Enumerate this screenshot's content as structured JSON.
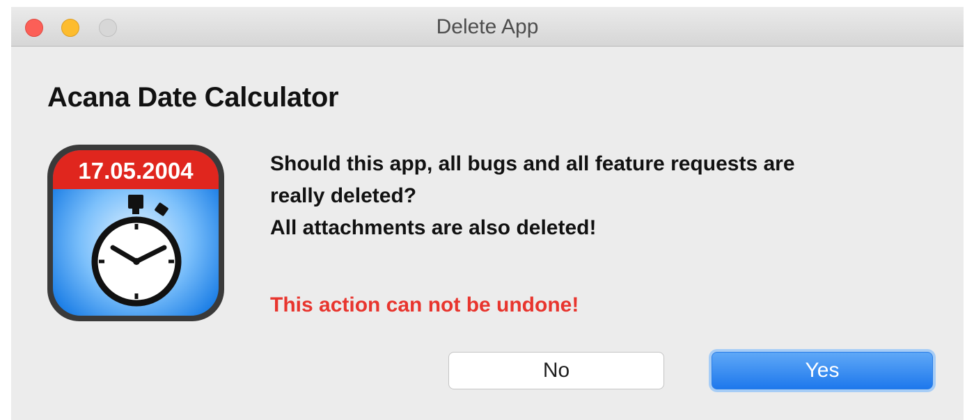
{
  "window": {
    "title": "Delete App"
  },
  "dialog": {
    "app_name": "Acana Date Calculator",
    "icon_date": "17.05.2004",
    "message_lines": [
      "Should this app, all bugs and all feature requests are",
      "really deleted?",
      "All attachments are also deleted!"
    ],
    "warning": "This action can not be undone!",
    "buttons": {
      "no_label": "No",
      "yes_label": "Yes"
    }
  },
  "colors": {
    "warning_text": "#e8352e",
    "primary_button": "#1e78ec",
    "icon_banner": "#e0261e",
    "icon_face": "#2a8ff0"
  },
  "icons": {
    "app_icon": "stopwatch-calendar-icon"
  }
}
